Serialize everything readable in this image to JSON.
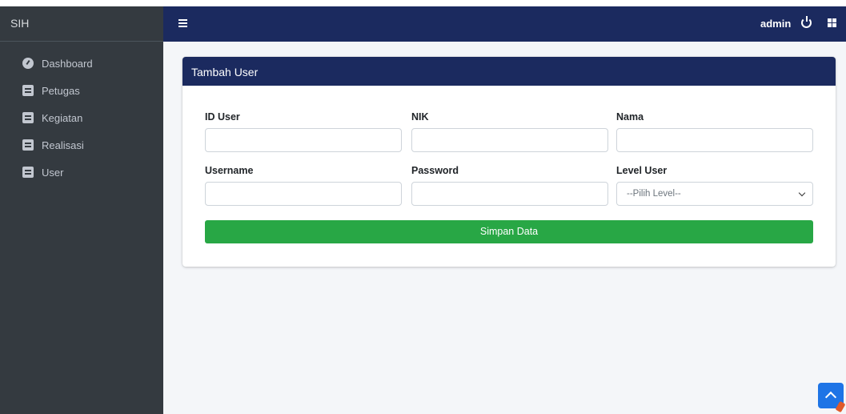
{
  "brand": "SIH",
  "sidebar": {
    "items": [
      {
        "label": "Dashboard",
        "icon": "dashboard-icon"
      },
      {
        "label": "Petugas",
        "icon": "book-icon"
      },
      {
        "label": "Kegiatan",
        "icon": "book-icon"
      },
      {
        "label": "Realisasi",
        "icon": "book-icon"
      },
      {
        "label": "User",
        "icon": "book-icon"
      }
    ]
  },
  "topbar": {
    "user": "admin",
    "icons": [
      "menu-icon",
      "power-icon",
      "grid-icon"
    ]
  },
  "card": {
    "title": "Tambah User",
    "fields": {
      "id_user": {
        "label": "ID User",
        "value": ""
      },
      "nik": {
        "label": "NIK",
        "value": ""
      },
      "nama": {
        "label": "Nama",
        "value": ""
      },
      "username": {
        "label": "Username",
        "value": ""
      },
      "password": {
        "label": "Password",
        "value": ""
      },
      "level": {
        "label": "Level User",
        "selected": "--Pilih Level--"
      }
    },
    "submit_label": "Simpan Data"
  },
  "colors": {
    "sidebar_bg": "#343a40",
    "header_bg": "#1b2a5f",
    "button_green": "#28a745",
    "scroll_button": "#1e74e6"
  }
}
